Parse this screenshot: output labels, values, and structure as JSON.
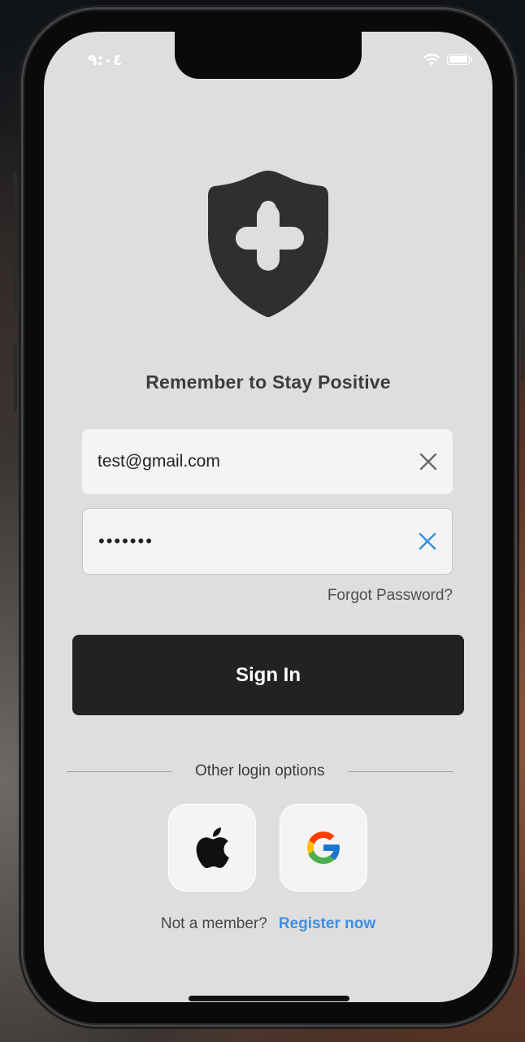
{
  "status_bar": {
    "time": "٩:٠٤",
    "signal_dots": "....",
    "icons": [
      "wifi-icon",
      "battery-icon"
    ]
  },
  "logo": {
    "icon": "shield-plus-icon",
    "color": "#2f2f2f"
  },
  "title": "Remember to Stay Positive",
  "form": {
    "email_value": "test@gmail.com",
    "password_value": "•••••••",
    "email_clear_icon": "close-icon",
    "password_clear_icon": "close-icon",
    "forgot_password": "Forgot Password?",
    "sign_in_label": "Sign In"
  },
  "divider": {
    "text": "Other login options"
  },
  "social_logins": [
    {
      "name": "apple",
      "icon": "apple-icon"
    },
    {
      "name": "google",
      "icon": "google-icon"
    }
  ],
  "register": {
    "prompt": "Not a member?",
    "link": "Register now"
  },
  "colors": {
    "screen_bg": "#dedede",
    "field_bg": "#f4f4f4",
    "button_bg": "#222222",
    "link": "#3f8fe0",
    "password_clear_icon": "#3f8fe0",
    "email_clear_icon": "#6b6b6b"
  }
}
